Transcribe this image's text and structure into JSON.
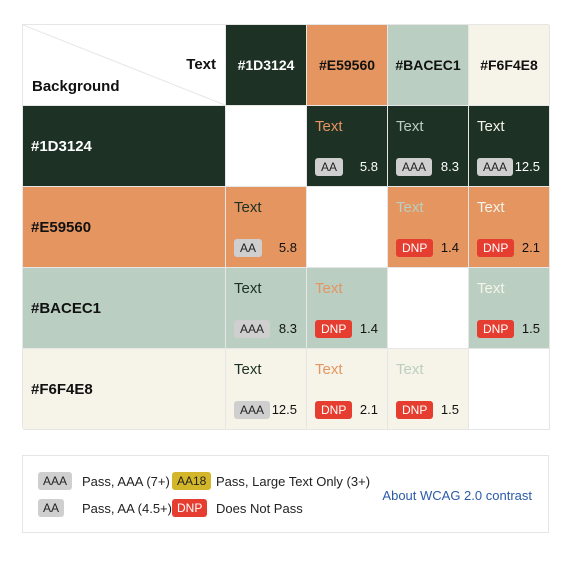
{
  "header": {
    "text_label": "Text",
    "background_label": "Background"
  },
  "colors": [
    {
      "hex": "#1D3124",
      "label": "#1D3124",
      "header_text_color": "#ffffff"
    },
    {
      "hex": "#E59560",
      "label": "#E59560",
      "header_text_color": "#111111"
    },
    {
      "hex": "#BACEC1",
      "label": "#BACEC1",
      "header_text_color": "#111111"
    },
    {
      "hex": "#F6F4E8",
      "label": "#F6F4E8",
      "header_text_color": "#111111"
    }
  ],
  "sample_text": "Text",
  "grid": [
    [
      null,
      {
        "badge": "AA",
        "level": "pass",
        "ratio": "5.8"
      },
      {
        "badge": "AAA",
        "level": "pass",
        "ratio": "8.3"
      },
      {
        "badge": "AAA",
        "level": "pass",
        "ratio": "12.5"
      }
    ],
    [
      {
        "badge": "AA",
        "level": "pass",
        "ratio": "5.8"
      },
      null,
      {
        "badge": "DNP",
        "level": "fail",
        "ratio": "1.4"
      },
      {
        "badge": "DNP",
        "level": "fail",
        "ratio": "2.1"
      }
    ],
    [
      {
        "badge": "AAA",
        "level": "pass",
        "ratio": "8.3"
      },
      {
        "badge": "DNP",
        "level": "fail",
        "ratio": "1.4"
      },
      null,
      {
        "badge": "DNP",
        "level": "fail",
        "ratio": "1.5"
      }
    ],
    [
      {
        "badge": "AAA",
        "level": "pass",
        "ratio": "12.5"
      },
      {
        "badge": "DNP",
        "level": "fail",
        "ratio": "2.1"
      },
      {
        "badge": "DNP",
        "level": "fail",
        "ratio": "1.5"
      },
      null
    ]
  ],
  "legend": {
    "aaa_badge": "AAA",
    "aaa_text": "Pass, AAA (7+)",
    "aa18_badge": "AA18",
    "aa18_text": "Pass, Large Text Only (3+)",
    "aa_badge": "AA",
    "aa_text": "Pass, AA (4.5+)",
    "dnp_badge": "DNP",
    "dnp_text": "Does Not Pass",
    "link_text": "About WCAG 2.0 contrast"
  },
  "accent_colors": {
    "pass_badge": "#cfcfcf",
    "fail_badge": "#e53e30",
    "large_text_badge": "#d4b62a",
    "link": "#2b5aa8"
  }
}
